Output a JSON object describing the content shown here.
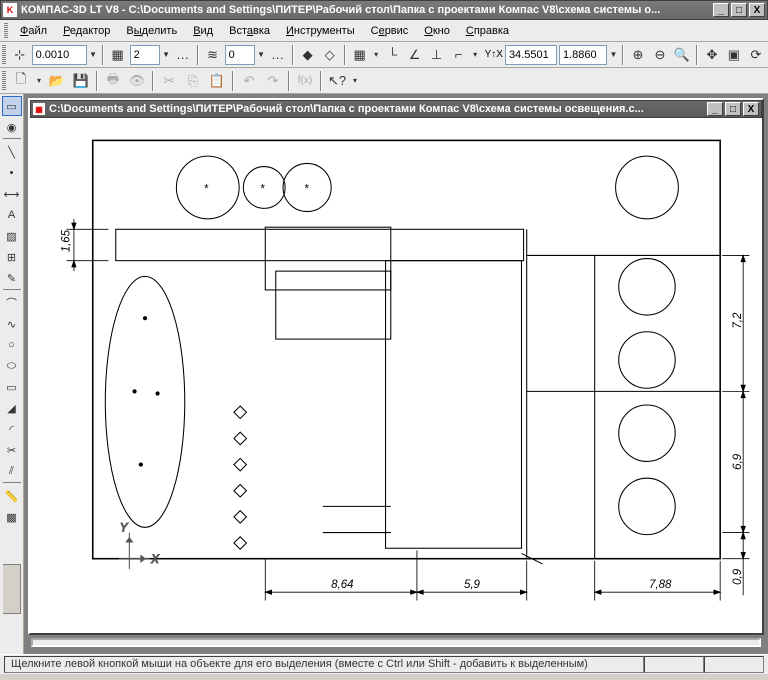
{
  "app": {
    "title": "КОМПАС-3D LT V8 - C:\\Documents and Settings\\ПИТЕР\\Рабочий стол\\Папка с проектами Компас V8\\схема системы о..."
  },
  "menu": {
    "file": "Файл",
    "editor": "Редактор",
    "select": "Выделить",
    "view": "Вид",
    "insert": "Вставка",
    "tools": "Инструменты",
    "service": "Сервис",
    "window": "Окно",
    "help": "Справка"
  },
  "toolbar1": {
    "step": "0.0010",
    "layer": "2",
    "lstyle": "0",
    "coord_label": "Y↑X",
    "x": "34.5501",
    "y": "1.8860"
  },
  "doc": {
    "title": "C:\\Documents and Settings\\ПИТЕР\\Рабочий стол\\Папка с проектами Компас V8\\схема системы освещения.c..."
  },
  "drawing": {
    "dims": {
      "h1": "1,65",
      "w1": "8,64",
      "w2": "5,9",
      "w3": "7,88",
      "v1": "7,2",
      "v2": "6,9",
      "v3": "0,9"
    },
    "axes": {
      "x": "X",
      "y": "Y"
    }
  },
  "status": {
    "text": "Щелкните левой кнопкой мыши на объекте для его выделения (вместе с Ctrl или Shift - добавить к выделенным)"
  }
}
